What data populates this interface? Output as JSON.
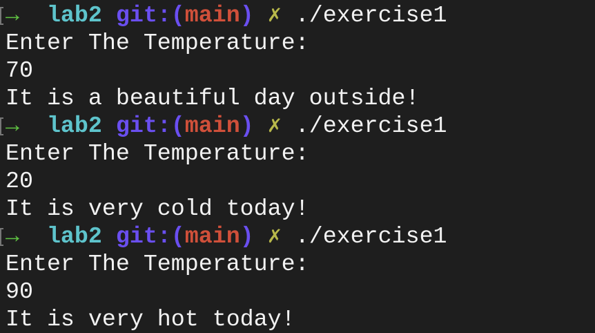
{
  "prompt": {
    "arrow": "→",
    "dir": "lab2",
    "git_prefix": "git:(",
    "branch": "main",
    "git_suffix": ")",
    "dirty": "✗",
    "command": "./exercise1"
  },
  "colors": {
    "arrow": "#5fc142",
    "dir": "#5ec4cc",
    "git": "#6a4ff0",
    "branch": "#d0503a",
    "dirty": "#b8b84a",
    "background": "#1e1e1e"
  },
  "runs": [
    {
      "prompt_text": "Enter The Temperature:",
      "input": "70",
      "output": "It is a beautiful day outside!"
    },
    {
      "prompt_text": "Enter The Temperature:",
      "input": "20",
      "output": "It is very cold today!"
    },
    {
      "prompt_text": "Enter The Temperature:",
      "input": "90",
      "output": "It is very hot today!"
    }
  ]
}
